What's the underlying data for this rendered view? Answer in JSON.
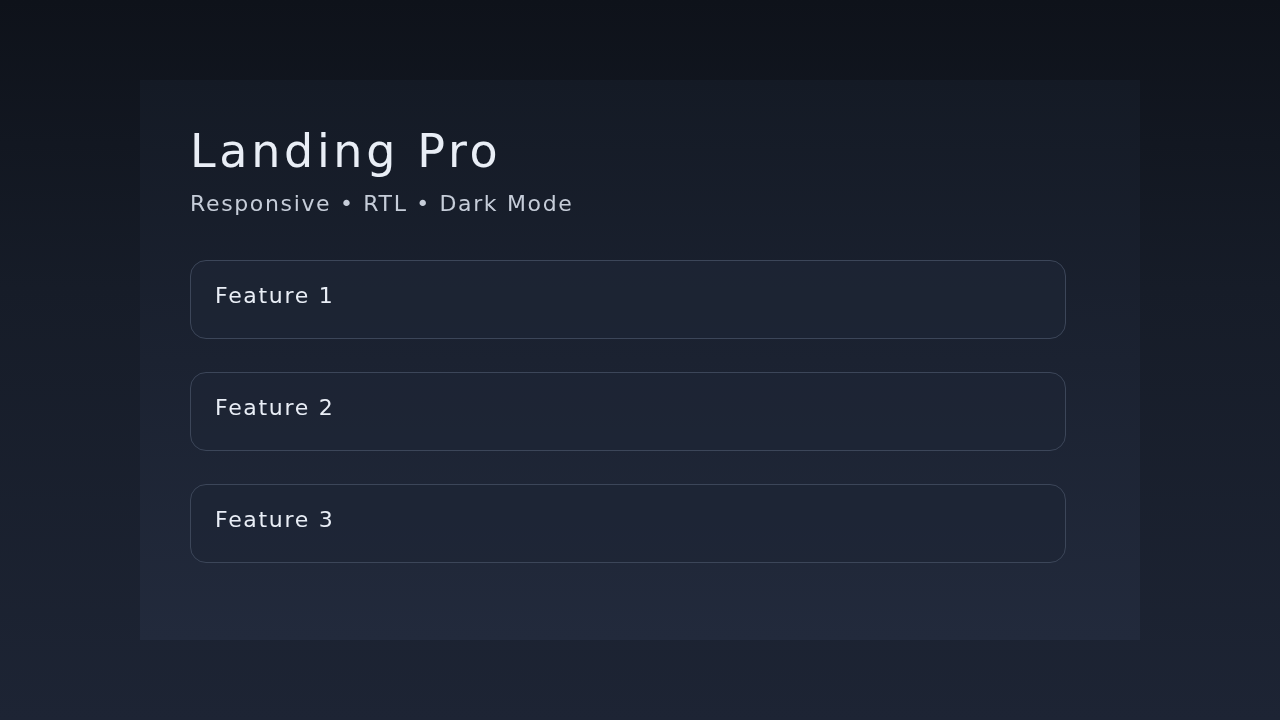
{
  "hero": {
    "title": "Landing Pro",
    "subtitle": "Responsive • RTL • Dark Mode"
  },
  "features": [
    {
      "label": "Feature 1"
    },
    {
      "label": "Feature 2"
    },
    {
      "label": "Feature 3"
    }
  ]
}
